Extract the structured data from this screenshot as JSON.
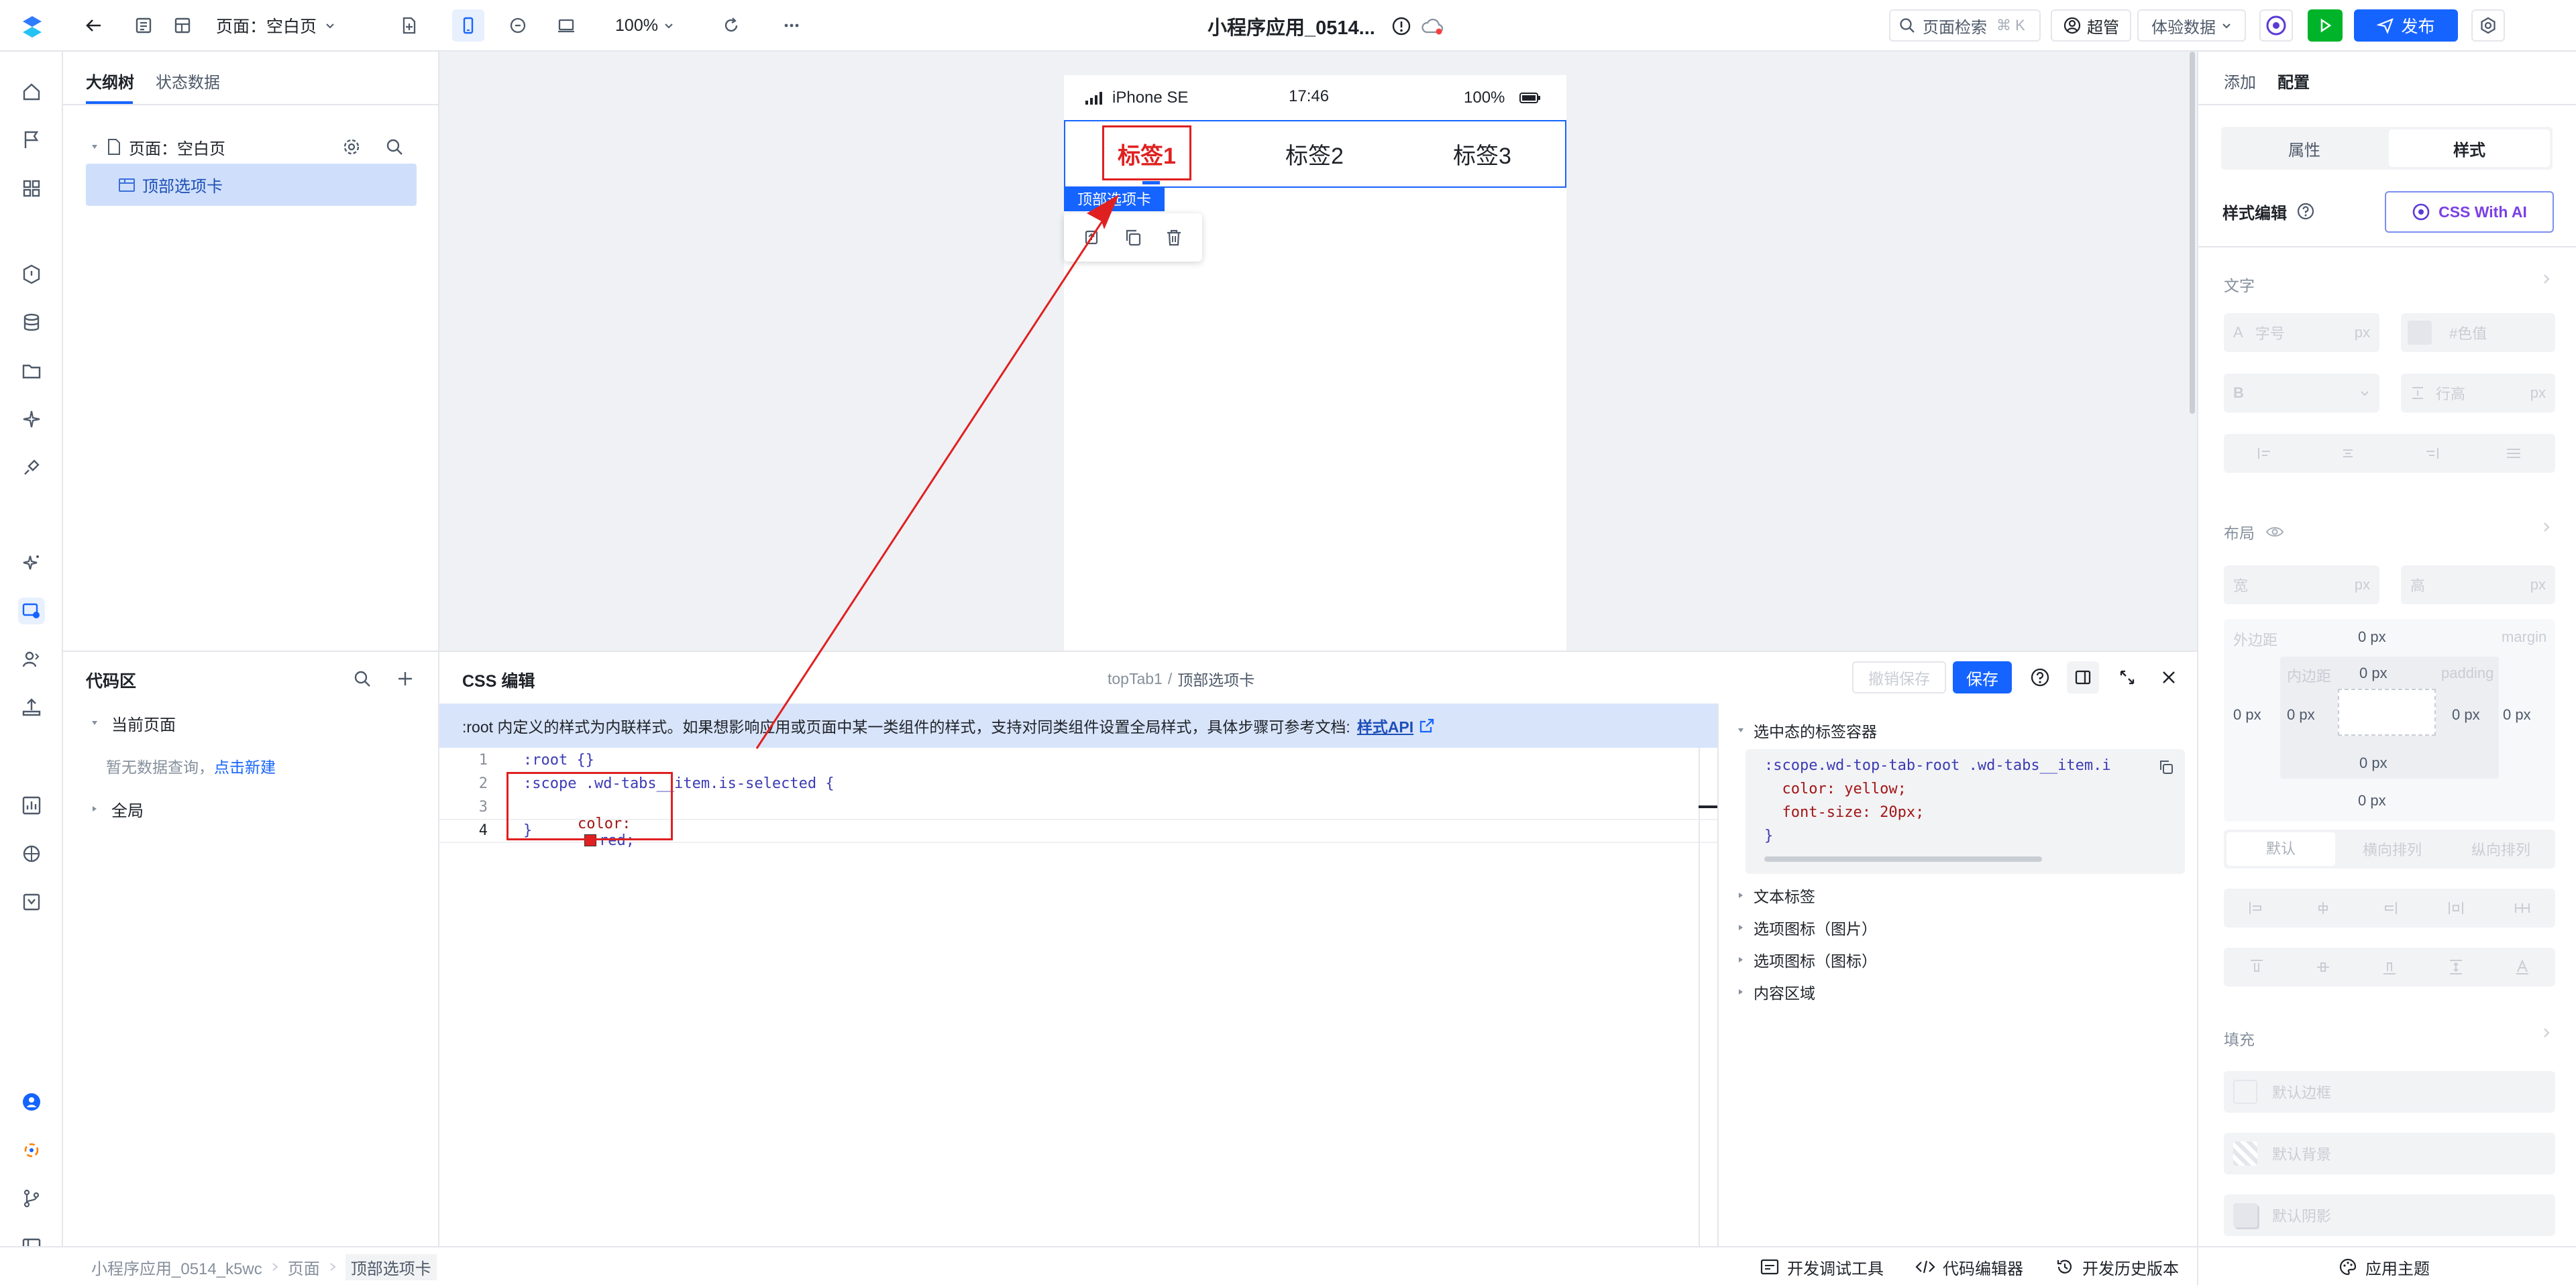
{
  "topbar": {
    "page_label": "页面：空白页",
    "zoom": "100%",
    "title": "小程序应用_0514...",
    "search_placeholder": "页面检索",
    "search_shortcut": "⌘ K",
    "user": "超管",
    "data_mode": "体验数据",
    "publish": "发布"
  },
  "outline": {
    "tabs": [
      "大纲树",
      "状态数据"
    ],
    "page_node": "页面：空白页",
    "child_node": "顶部选项卡"
  },
  "codezone": {
    "title": "代码区",
    "current_page": "当前页面",
    "empty_text": "暂无数据查询，",
    "create_link": "点击新建",
    "global": "全局"
  },
  "phone": {
    "device": "iPhone SE",
    "time": "17:46",
    "battery": "100%",
    "tabs": [
      "标签1",
      "标签2",
      "标签3"
    ],
    "selection_tag": "顶部选项卡",
    "selected_color": "#e02020"
  },
  "csseditor": {
    "title": "CSS 编辑",
    "breadcrumb_id": "topTab1",
    "breadcrumb_sep": "/",
    "breadcrumb_name": "顶部选项卡",
    "undo_save": "撤销保存",
    "save": "保存",
    "notice": ":root 内定义的样式为内联样式。如果想影响应用或页面中某一类组件的样式，支持对同类组件设置全局样式，具体步骤可参考文档:",
    "notice_link": "样式API",
    "lines": [
      {
        "n": "1",
        "text": ":root {}"
      },
      {
        "n": "2",
        "text": ":scope .wd-tabs__item.is-selected {"
      },
      {
        "n": "3",
        "prop": "color:",
        "value": "red;"
      },
      {
        "n": "4",
        "text": "}"
      }
    ],
    "ref_title": "选中态的标签容器",
    "ref_code": [
      ":scope.wd-top-tab-root .wd-tabs__item.i",
      "  color: yellow;",
      "  font-size: 20px;",
      "}"
    ],
    "sections": [
      "文本标签",
      "选项图标（图片）",
      "选项图标（图标）",
      "内容区域"
    ]
  },
  "config": {
    "tabs": [
      "添加",
      "配置"
    ],
    "seg": [
      "属性",
      "样式"
    ],
    "style_edit": "样式编辑",
    "css_ai": "CSS With AI",
    "text_section": "文字",
    "font_size_placeholder": "字号",
    "unit_px": "px",
    "color_placeholder": "#色值",
    "line_height_placeholder": "行高",
    "layout_section": "布局",
    "width_label": "宽",
    "height_label": "高",
    "margin_label": "外边距",
    "margin_tag": "margin",
    "padding_label": "内边距",
    "padding_tag": "padding",
    "zero_px": "0 px",
    "layout_modes": [
      "默认",
      "横向排列",
      "纵向排列"
    ],
    "fill_section": "填充",
    "fill_items": [
      "默认边框",
      "默认背景",
      "默认阴影"
    ]
  },
  "status": {
    "breadcrumb": [
      "小程序应用_0514_k5wc",
      "页面",
      "顶部选项卡"
    ],
    "debug": "开发调试工具",
    "code_editor": "代码编辑器",
    "history": "开发历史版本",
    "theme": "应用主题"
  },
  "colors": {
    "primary": "#1664ff",
    "success": "#00b42a",
    "ai": "#7b3fe4",
    "annotation": "#e02020"
  }
}
